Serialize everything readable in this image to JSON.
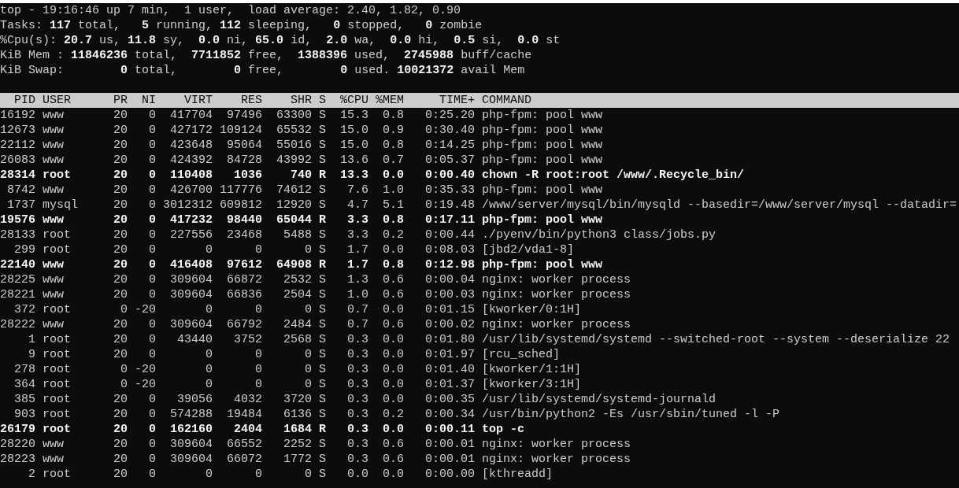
{
  "summary": [
    "top - 19:16:46 up 7 min,  1 user,  load average: 2.40, 1.82, 0.90",
    "Tasks: **117** total,   **5** running, **112** sleeping,   **0** stopped,   **0** zombie",
    "%Cpu(s): **20.7** us, **11.8** sy,  **0.0** ni, **65.0** id,  **2.0** wa,  **0.0** hi,  **0.5** si,  **0.0** st",
    "KiB Mem : **11846236** total,  **7711852** free,  **1388396** used,  **2745988** buff/cache",
    "KiB Swap:        **0** total,        **0** free,        **0** used. **10021372** avail Mem"
  ],
  "columns": [
    "PID",
    "USER",
    "PR",
    "NI",
    "VIRT",
    "RES",
    "SHR",
    "S",
    "%CPU",
    "%MEM",
    "TIME+",
    "COMMAND"
  ],
  "rows": [
    {
      "bold": false,
      "cells": [
        "16192",
        "www",
        "20",
        "0",
        "417704",
        "97496",
        "63300",
        "S",
        "15.3",
        "0.8",
        "0:25.20",
        "php-fpm: pool www"
      ]
    },
    {
      "bold": false,
      "cells": [
        "12673",
        "www",
        "20",
        "0",
        "427172",
        "109124",
        "65532",
        "S",
        "15.0",
        "0.9",
        "0:30.40",
        "php-fpm: pool www"
      ]
    },
    {
      "bold": false,
      "cells": [
        "22112",
        "www",
        "20",
        "0",
        "423648",
        "95064",
        "55016",
        "S",
        "15.0",
        "0.8",
        "0:14.25",
        "php-fpm: pool www"
      ]
    },
    {
      "bold": false,
      "cells": [
        "26083",
        "www",
        "20",
        "0",
        "424392",
        "84728",
        "43992",
        "S",
        "13.6",
        "0.7",
        "0:05.37",
        "php-fpm: pool www"
      ]
    },
    {
      "bold": true,
      "cells": [
        "28314",
        "root",
        "20",
        "0",
        "110408",
        "1036",
        "740",
        "R",
        "13.3",
        "0.0",
        "0:00.40",
        "chown -R root:root /www/.Recycle_bin/"
      ]
    },
    {
      "bold": false,
      "cells": [
        "8742",
        "www",
        "20",
        "0",
        "426700",
        "117776",
        "74612",
        "S",
        "7.6",
        "1.0",
        "0:35.33",
        "php-fpm: pool www"
      ]
    },
    {
      "bold": false,
      "cells": [
        "1737",
        "mysql",
        "20",
        "0",
        "3012312",
        "609812",
        "12920",
        "S",
        "4.7",
        "5.1",
        "0:19.48",
        "/www/server/mysql/bin/mysqld --basedir=/www/server/mysql --datadir="
      ]
    },
    {
      "bold": true,
      "cells": [
        "19576",
        "www",
        "20",
        "0",
        "417232",
        "98440",
        "65044",
        "R",
        "3.3",
        "0.8",
        "0:17.11",
        "php-fpm: pool www"
      ]
    },
    {
      "bold": false,
      "cells": [
        "28133",
        "root",
        "20",
        "0",
        "227556",
        "23468",
        "5488",
        "S",
        "3.3",
        "0.2",
        "0:00.44",
        "./pyenv/bin/python3 class/jobs.py"
      ]
    },
    {
      "bold": false,
      "cells": [
        "299",
        "root",
        "20",
        "0",
        "0",
        "0",
        "0",
        "S",
        "1.7",
        "0.0",
        "0:08.03",
        "[jbd2/vda1-8]"
      ]
    },
    {
      "bold": true,
      "cells": [
        "22140",
        "www",
        "20",
        "0",
        "416408",
        "97612",
        "64908",
        "R",
        "1.7",
        "0.8",
        "0:12.98",
        "php-fpm: pool www"
      ]
    },
    {
      "bold": false,
      "cells": [
        "28225",
        "www",
        "20",
        "0",
        "309604",
        "66872",
        "2532",
        "S",
        "1.3",
        "0.6",
        "0:00.04",
        "nginx: worker process"
      ]
    },
    {
      "bold": false,
      "cells": [
        "28221",
        "www",
        "20",
        "0",
        "309604",
        "66836",
        "2504",
        "S",
        "1.0",
        "0.6",
        "0:00.03",
        "nginx: worker process"
      ]
    },
    {
      "bold": false,
      "cells": [
        "372",
        "root",
        "0",
        "-20",
        "0",
        "0",
        "0",
        "S",
        "0.7",
        "0.0",
        "0:01.15",
        "[kworker/0:1H]"
      ]
    },
    {
      "bold": false,
      "cells": [
        "28222",
        "www",
        "20",
        "0",
        "309604",
        "66792",
        "2484",
        "S",
        "0.7",
        "0.6",
        "0:00.02",
        "nginx: worker process"
      ]
    },
    {
      "bold": false,
      "cells": [
        "1",
        "root",
        "20",
        "0",
        "43440",
        "3752",
        "2568",
        "S",
        "0.3",
        "0.0",
        "0:01.80",
        "/usr/lib/systemd/systemd --switched-root --system --deserialize 22"
      ]
    },
    {
      "bold": false,
      "cells": [
        "9",
        "root",
        "20",
        "0",
        "0",
        "0",
        "0",
        "S",
        "0.3",
        "0.0",
        "0:01.97",
        "[rcu_sched]"
      ]
    },
    {
      "bold": false,
      "cells": [
        "278",
        "root",
        "0",
        "-20",
        "0",
        "0",
        "0",
        "S",
        "0.3",
        "0.0",
        "0:01.40",
        "[kworker/1:1H]"
      ]
    },
    {
      "bold": false,
      "cells": [
        "364",
        "root",
        "0",
        "-20",
        "0",
        "0",
        "0",
        "S",
        "0.3",
        "0.0",
        "0:01.37",
        "[kworker/3:1H]"
      ]
    },
    {
      "bold": false,
      "cells": [
        "385",
        "root",
        "20",
        "0",
        "39056",
        "4032",
        "3720",
        "S",
        "0.3",
        "0.0",
        "0:00.35",
        "/usr/lib/systemd/systemd-journald"
      ]
    },
    {
      "bold": false,
      "cells": [
        "903",
        "root",
        "20",
        "0",
        "574288",
        "19484",
        "6136",
        "S",
        "0.3",
        "0.2",
        "0:00.34",
        "/usr/bin/python2 -Es /usr/sbin/tuned -l -P"
      ]
    },
    {
      "bold": true,
      "cells": [
        "26179",
        "root",
        "20",
        "0",
        "162160",
        "2404",
        "1684",
        "R",
        "0.3",
        "0.0",
        "0:00.11",
        "top -c"
      ]
    },
    {
      "bold": false,
      "cells": [
        "28220",
        "www",
        "20",
        "0",
        "309604",
        "66552",
        "2252",
        "S",
        "0.3",
        "0.6",
        "0:00.01",
        "nginx: worker process"
      ]
    },
    {
      "bold": false,
      "cells": [
        "28223",
        "www",
        "20",
        "0",
        "309604",
        "66072",
        "1772",
        "S",
        "0.3",
        "0.6",
        "0:00.01",
        "nginx: worker process"
      ]
    },
    {
      "bold": false,
      "cells": [
        "2",
        "root",
        "20",
        "0",
        "0",
        "0",
        "0",
        "S",
        "0.0",
        "0.0",
        "0:00.00",
        "[kthreadd]"
      ]
    }
  ]
}
